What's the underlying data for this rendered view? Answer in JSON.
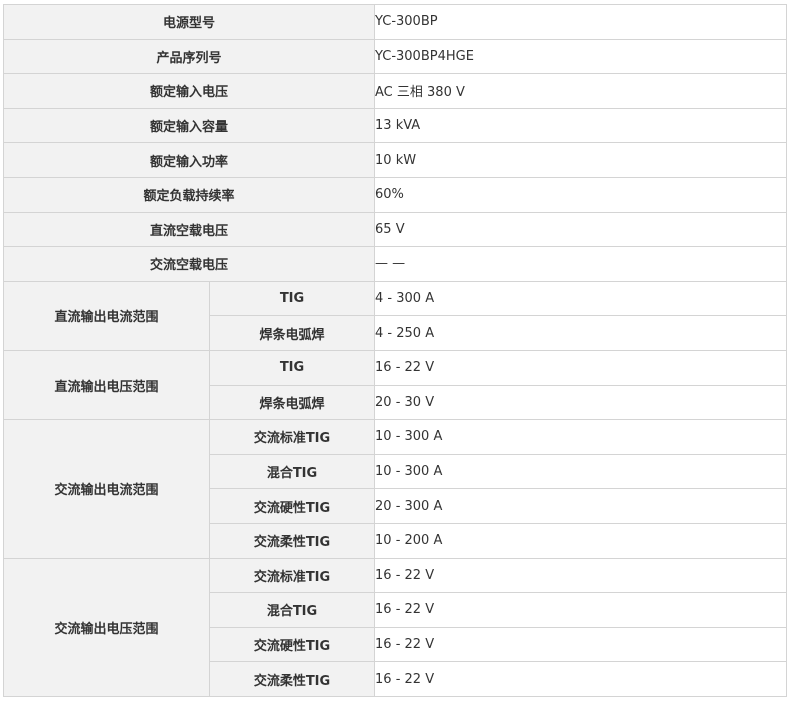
{
  "rows": [
    {
      "label": "电源型号",
      "value": "YC-300BP"
    },
    {
      "label": "产品序列号",
      "value": "YC-300BP4HGE"
    },
    {
      "label": "额定输入电压",
      "value": "AC 三相 380 V"
    },
    {
      "label": "额定输入容量",
      "value": "13 kVA"
    },
    {
      "label": "额定输入功率",
      "value": "10 kW"
    },
    {
      "label": "额定负载持续率",
      "value": "60%"
    },
    {
      "label": "直流空载电压",
      "value": "65 V"
    },
    {
      "label": "交流空载电压",
      "value": "— —"
    }
  ],
  "groups": [
    {
      "label": "直流输出电流范围",
      "subs": [
        {
          "label": "TIG",
          "value": "4 - 300 A"
        },
        {
          "label": "焊条电弧焊",
          "value": "4 - 250 A"
        }
      ]
    },
    {
      "label": "直流输出电压范围",
      "subs": [
        {
          "label": "TIG",
          "value": "16 - 22 V"
        },
        {
          "label": "焊条电弧焊",
          "value": "20 - 30 V"
        }
      ]
    },
    {
      "label": "交流输出电流范围",
      "subs": [
        {
          "label": "交流标准TIG",
          "value": "10 - 300 A"
        },
        {
          "label": "混合TIG",
          "value": "10 - 300 A"
        },
        {
          "label": "交流硬性TIG",
          "value": "20 - 300 A"
        },
        {
          "label": "交流柔性TIG",
          "value": "10 - 200 A"
        }
      ]
    },
    {
      "label": "交流输出电压范围",
      "subs": [
        {
          "label": "交流标准TIG",
          "value": "16 - 22 V"
        },
        {
          "label": "混合TIG",
          "value": "16 - 22 V"
        },
        {
          "label": "交流硬性TIG",
          "value": "16 - 22 V"
        },
        {
          "label": "交流柔性TIG",
          "value": "16 - 22 V"
        }
      ]
    }
  ]
}
